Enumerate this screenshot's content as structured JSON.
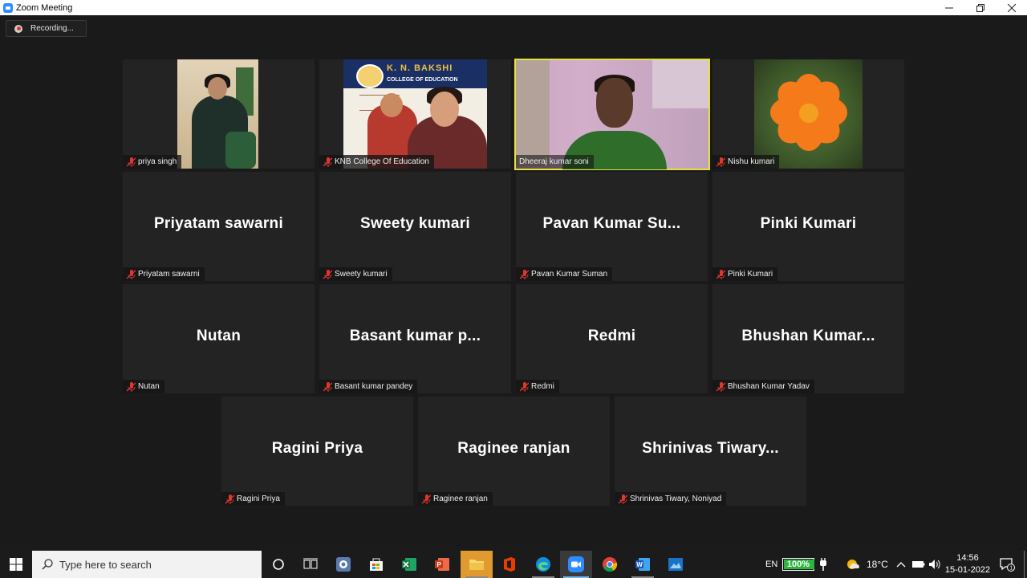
{
  "window": {
    "title": "Zoom Meeting",
    "minimize": "—",
    "maximize": "❐",
    "close": "✕"
  },
  "recording": {
    "label": "Recording..."
  },
  "participants": [
    {
      "label": "priya singh"
    },
    {
      "label": "KNB College Of Education"
    },
    {
      "label": "Dheeraj kumar soni"
    },
    {
      "label": "Nishu kumari"
    },
    {
      "display": "Priyatam sawarni",
      "label": "Priyatam sawarni"
    },
    {
      "display": "Sweety kumari",
      "label": "Sweety kumari"
    },
    {
      "display": "Pavan Kumar Su...",
      "label": "Pavan Kumar Suman"
    },
    {
      "display": "Pinki Kumari",
      "label": "Pinki Kumari"
    },
    {
      "display": "Nutan",
      "label": "Nutan"
    },
    {
      "display": "Basant kumar p...",
      "label": "Basant kumar pandey"
    },
    {
      "display": "Redmi",
      "label": "Redmi"
    },
    {
      "display": "Bhushan Kumar...",
      "label": "Bhushan Kumar Yadav"
    },
    {
      "display": "Ragini  Priya",
      "label": "Ragini  Priya"
    },
    {
      "display": "Raginee ranjan",
      "label": "Raginee ranjan"
    },
    {
      "display": "Shrinivas Tiwary...",
      "label": "Shrinivas Tiwary, Noniyad"
    }
  ],
  "knb_banner": {
    "title": "K. N. BAKSHI",
    "subtitle": "COLLEGE OF EDUCATION"
  },
  "taskbar": {
    "search_placeholder": "Type here to search",
    "language": "EN",
    "battery": "100%",
    "battery_level": 1.0,
    "weather": "18°C",
    "time": "14:56",
    "date": "15-01-2022",
    "notification_count": "1"
  },
  "colors": {
    "active_speaker": "#e5e03e",
    "mute_red": "#e0362e",
    "accent": "#2d8cff"
  }
}
